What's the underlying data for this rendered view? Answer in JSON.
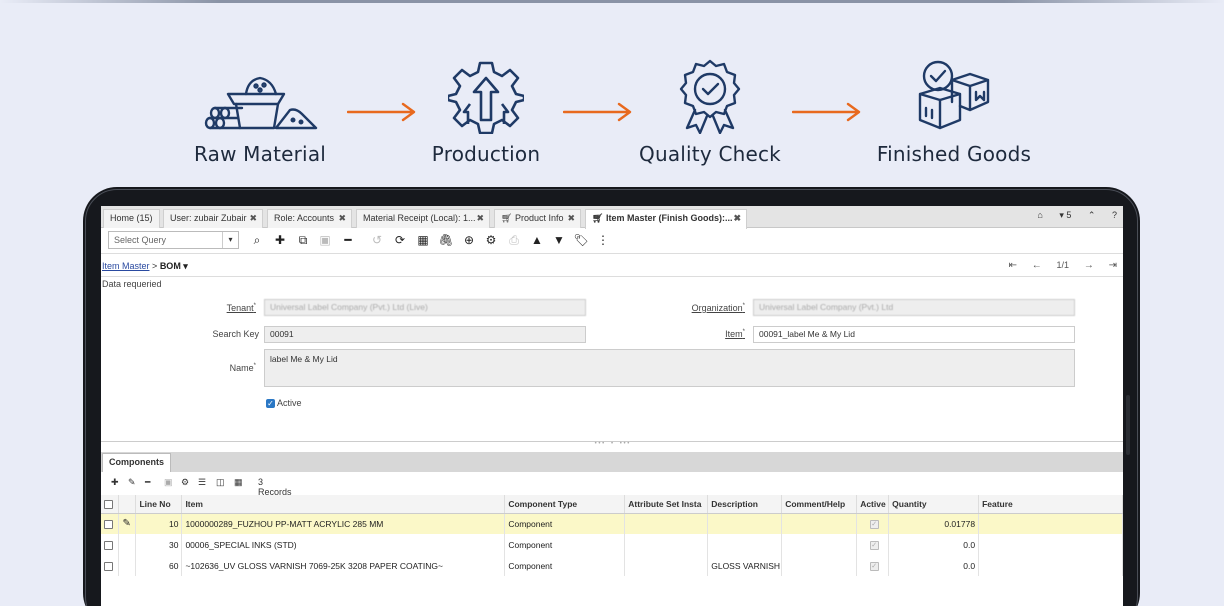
{
  "flow": {
    "steps": [
      {
        "label": "Raw Material",
        "icon": "raw-material-icon"
      },
      {
        "label": "Production",
        "icon": "production-gear-icon"
      },
      {
        "label": "Quality Check",
        "icon": "quality-badge-icon"
      },
      {
        "label": "Finished Goods",
        "icon": "finished-goods-boxes-icon"
      }
    ],
    "colors": {
      "icon": "#1f3a66",
      "arrow": "#e8691e",
      "text": "#1e2a3d"
    }
  },
  "app": {
    "tabs": [
      {
        "label": "Home (15)"
      },
      {
        "label": "User: zubair Zubair"
      },
      {
        "label": "Role: Accounts"
      },
      {
        "label": "Material Receipt (Local): 1..."
      },
      {
        "label": "Product Info"
      },
      {
        "label": "Item Master (Finish Goods):..."
      }
    ],
    "tab_icons": {
      "home": "⌂",
      "notices": "▾ 5",
      "collapse": "⌃",
      "help": "?"
    },
    "toolbar": {
      "select_query": "Select Query"
    },
    "breadcrumb": {
      "parent": "Item Master",
      "sep": ">",
      "current": "BOM ▾"
    },
    "pager": {
      "record": "1/1"
    },
    "status": "Data requeried",
    "form": {
      "tenant_label": "Tenant",
      "tenant_value": "Universal Label Company (Pvt.) Ltd (Live)",
      "org_label": "Organization",
      "org_value": "Universal Label Company (Pvt.) Ltd",
      "searchkey_label": "Search Key",
      "searchkey_value": "00091",
      "item_label": "Item",
      "item_value": "00091_label Me & My Lid",
      "name_label": "Name",
      "name_value": "label Me & My Lid",
      "active_label": "Active"
    },
    "components": {
      "tab_label": "Components",
      "records": "3 Records",
      "columns": [
        "Line No",
        "Item",
        "Component Type",
        "Attribute Set Insta",
        "Description",
        "Comment/Help",
        "Active",
        "Quantity",
        "Feature"
      ],
      "rows": [
        {
          "line": "10",
          "item": "1000000289_FUZHOU PP-MATT ACRYLIC 285 MM",
          "type": "Component",
          "attr": "",
          "desc": "",
          "comment": "",
          "qty": "0.01778",
          "feature": ""
        },
        {
          "line": "30",
          "item": "00006_SPECIAL INKS (STD)",
          "type": "Component",
          "attr": "",
          "desc": "",
          "comment": "",
          "qty": "0.0",
          "feature": ""
        },
        {
          "line": "60",
          "item": "~102636_UV GLOSS VARNISH 7069-25K 3208 PAPER COATING~",
          "type": "Component",
          "attr": "",
          "desc": "GLOSS VARNISH",
          "comment": "",
          "qty": "0.0",
          "feature": ""
        }
      ]
    }
  }
}
